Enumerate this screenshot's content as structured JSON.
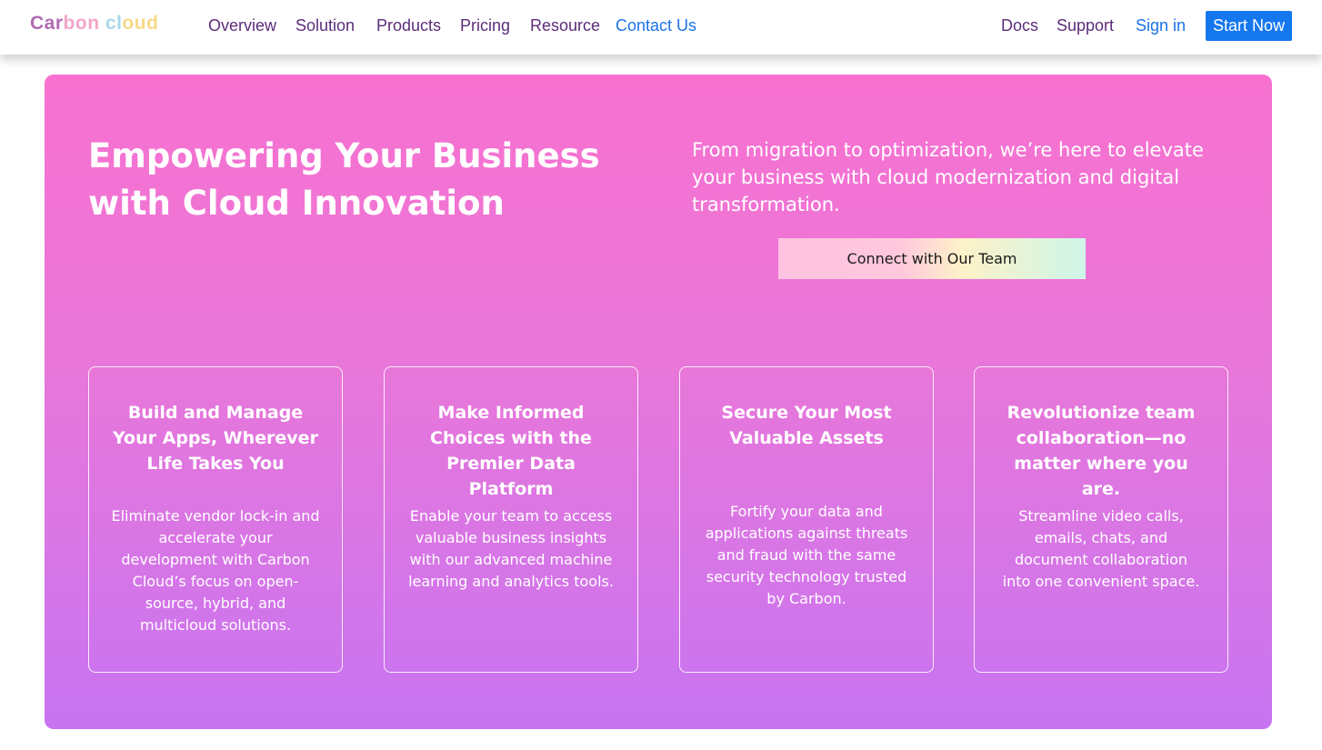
{
  "navbar": {
    "brand": "Carbon cloud",
    "links": [
      "Overview",
      "Solution",
      "Products",
      "Pricing",
      "Resource",
      "Contact Us"
    ],
    "right_links": [
      "Docs",
      "Support",
      "Sign in"
    ],
    "cta": "Start Now"
  },
  "hero": {
    "title": "Empowering Your Business with Cloud Innovation",
    "subtitle": "From migration to optimization, we’re here to elevate your business with cloud modernization and digital transformation.",
    "button": "Connect with Our Team"
  },
  "cards": [
    {
      "title": "Build and Manage Your Apps, Wherever Life Takes You",
      "body": "Eliminate vendor lock-in and accelerate your development with Carbon Cloud’s focus on open-source, hybrid, and multicloud solutions."
    },
    {
      "title": "Make Informed Choices with the Premier Data Platform",
      "body": "Enable your team to access valuable business insights with our advanced machine learning and analytics tools."
    },
    {
      "title": "Secure Your Most Valuable Assets",
      "body": "Fortify your data and applications against threats and fraud with the same security technology trusted by Carbon."
    },
    {
      "title": "Revolutionize team collaboration—no matter where you are.",
      "body": "Streamline video calls, emails, chats, and document collaboration into one convenient space."
    }
  ],
  "colors": {
    "brand_gradient": [
      "#b06ab3",
      "#f2a6c9",
      "#a6d8e8",
      "#f6d98a"
    ],
    "nav_text": "#5b2d7a",
    "link_blue": "#1a73e8",
    "cta_blue": "#1577ee",
    "hero_top": "#f871d0",
    "hero_bottom": "#c774f2"
  }
}
